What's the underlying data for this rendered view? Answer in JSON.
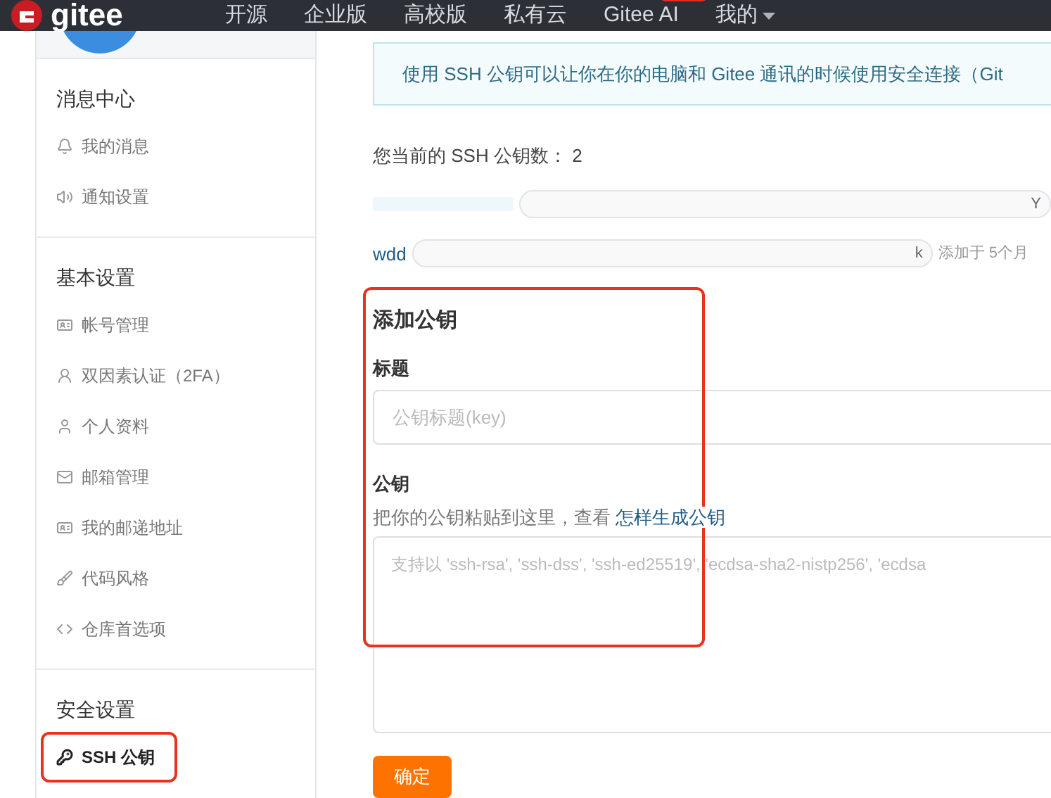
{
  "navbar": {
    "logo": "gitee",
    "items": [
      {
        "label": "开源",
        "kind": "link"
      },
      {
        "label": "企业版",
        "kind": "link"
      },
      {
        "label": "高校版",
        "kind": "link"
      },
      {
        "label": "私有云",
        "kind": "link"
      },
      {
        "label": "Gitee AI",
        "kind": "badged"
      },
      {
        "label": "我的",
        "kind": "dropdown"
      }
    ]
  },
  "sidebar": {
    "sections": [
      {
        "title": "消息中心",
        "items": [
          {
            "label": "我的消息",
            "kind": "bell",
            "selected": false,
            "highlighted": false
          },
          {
            "label": "通知设置",
            "kind": "speaker",
            "selected": false,
            "highlighted": false
          }
        ]
      },
      {
        "title": "基本设置",
        "items": [
          {
            "label": "帐号管理",
            "kind": "card",
            "selected": false,
            "highlighted": false
          },
          {
            "label": "双因素认证（2FA）",
            "kind": "person",
            "selected": false,
            "highlighted": false
          },
          {
            "label": "个人资料",
            "kind": "user",
            "selected": false,
            "highlighted": false
          },
          {
            "label": "邮箱管理",
            "kind": "mail",
            "selected": false,
            "highlighted": false
          },
          {
            "label": "我的邮递地址",
            "kind": "card",
            "selected": false,
            "highlighted": false
          },
          {
            "label": "代码风格",
            "kind": "brush",
            "selected": false,
            "highlighted": false
          },
          {
            "label": "仓库首选项",
            "kind": "code",
            "selected": false,
            "highlighted": false
          }
        ]
      },
      {
        "title": "安全设置",
        "items": [
          {
            "label": "SSH 公钥",
            "kind": "key",
            "selected": true,
            "highlighted": true
          }
        ]
      }
    ]
  },
  "main": {
    "notice": "使用 SSH 公钥可以让你在你的电脑和 Gitee 通讯的时候使用安全连接（Git",
    "key_count_label": "您当前的 SSH 公钥数：",
    "key_count": "2",
    "keys": [
      {
        "fingerprint_end": "Y"
      },
      {
        "name": "wdd",
        "fingerprint_end": "k",
        "added": "添加于 5个月"
      }
    ],
    "form": {
      "heading": "添加公钥",
      "highlighted": true,
      "title_label": "标题",
      "title_placeholder": "公钥标题(key)",
      "key_label": "公钥",
      "key_help": "把你的公钥粘贴到这里，查看 ",
      "key_help_link": "怎样生成公钥",
      "key_placeholder": "支持以 'ssh-rsa', 'ssh-dss', 'ssh-ed25519', 'ecdsa-sha2-nistp256', 'ecdsa",
      "submit": "确定"
    }
  }
}
